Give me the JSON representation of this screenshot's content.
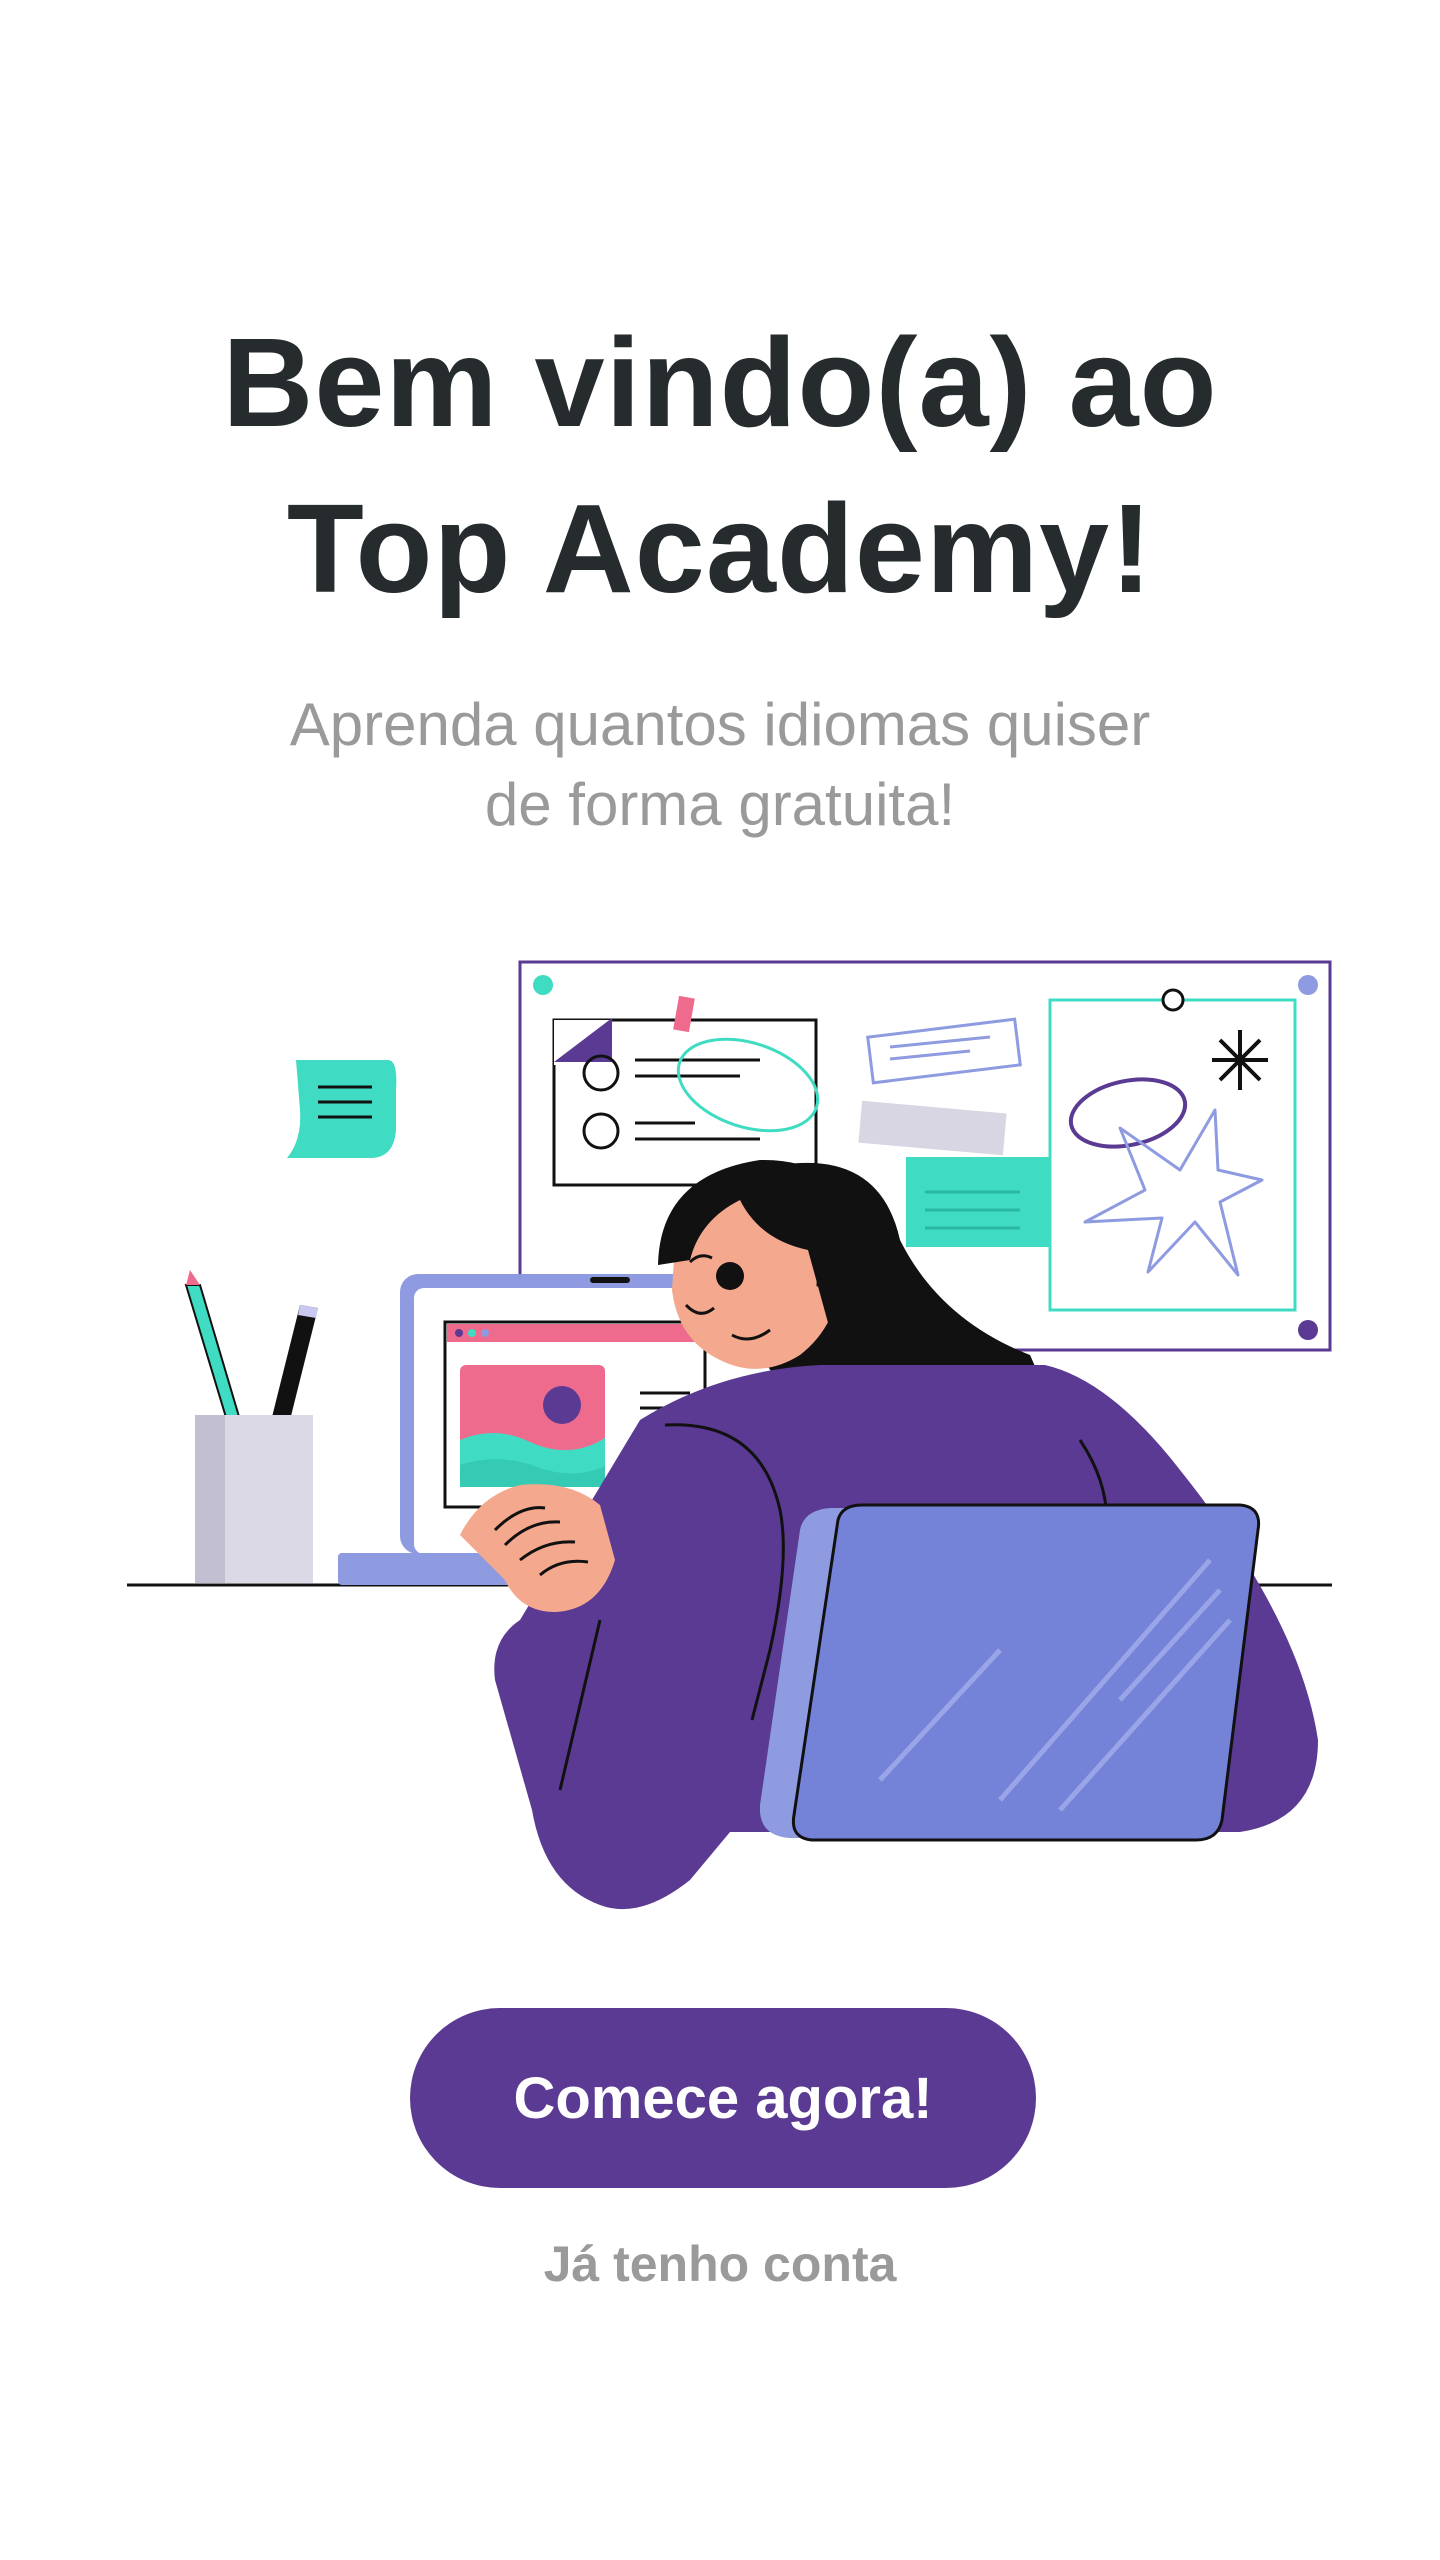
{
  "welcome": {
    "title_line1": "Bem vindo(a) ao",
    "title_line2": "Top Academy!",
    "subtitle_line1": "Aprenda quantos idiomas quiser",
    "subtitle_line2": "de forma gratuita!"
  },
  "actions": {
    "start_label": "Comece agora!",
    "login_label": "Já tenho conta"
  },
  "colors": {
    "primary": "#5a3a92",
    "title": "#262b2d",
    "muted": "#9a9a9a",
    "accent_teal": "#3fdcc3",
    "accent_lavender": "#8e9be0",
    "accent_pink": "#ef6b8e"
  },
  "illustration": {
    "name": "woman-at-laptop-illustration"
  }
}
